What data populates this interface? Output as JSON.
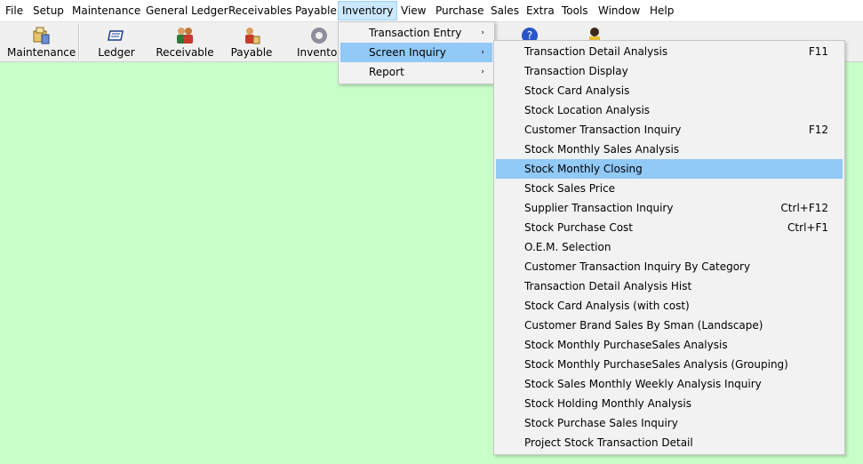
{
  "menubar": [
    "File",
    "Setup",
    "Maintenance",
    "General Ledger",
    "Receivables",
    "Payable",
    "Inventory",
    "View",
    "Purchase",
    "Sales",
    "Extra",
    "Tools",
    "Window",
    "Help"
  ],
  "toolbar": [
    "Maintenance",
    "Ledger",
    "Receivable",
    "Payable",
    "Inventory"
  ],
  "inventory_menu": {
    "items": [
      "Transaction Entry",
      "Screen Inquiry",
      "Report"
    ],
    "arrow": "›"
  },
  "screen_inquiry_menu": {
    "items": [
      {
        "label": "Transaction Detail Analysis",
        "shortcut": "F11"
      },
      {
        "label": "Transaction Display",
        "shortcut": ""
      },
      {
        "label": "Stock Card Analysis",
        "shortcut": ""
      },
      {
        "label": "Stock Location Analysis",
        "shortcut": ""
      },
      {
        "label": "Customer Transaction Inquiry",
        "shortcut": "F12"
      },
      {
        "label": "Stock Monthly Sales Analysis",
        "shortcut": ""
      },
      {
        "label": "Stock Monthly Closing",
        "shortcut": ""
      },
      {
        "label": "Stock Sales Price",
        "shortcut": ""
      },
      {
        "label": "Supplier Transaction Inquiry",
        "shortcut": "Ctrl+F12"
      },
      {
        "label": "Stock Purchase Cost",
        "shortcut": "Ctrl+F1"
      },
      {
        "label": "O.E.M. Selection",
        "shortcut": ""
      },
      {
        "label": "Customer Transaction Inquiry By Category",
        "shortcut": ""
      },
      {
        "label": "Transaction Detail Analysis Hist",
        "shortcut": ""
      },
      {
        "label": "Stock Card Analysis (with cost)",
        "shortcut": ""
      },
      {
        "label": "Customer Brand Sales By Sman (Landscape)",
        "shortcut": ""
      },
      {
        "label": "Stock Monthly PurchaseSales Analysis",
        "shortcut": ""
      },
      {
        "label": "Stock Monthly PurchaseSales Analysis (Grouping)",
        "shortcut": ""
      },
      {
        "label": "Stock Sales Monthly Weekly Analysis Inquiry",
        "shortcut": ""
      },
      {
        "label": "Stock Holding Monthly Analysis",
        "shortcut": ""
      },
      {
        "label": "Stock Purchase Sales Inquiry",
        "shortcut": ""
      },
      {
        "label": "Project Stock Transaction Detail",
        "shortcut": ""
      }
    ]
  },
  "colors": {
    "workspace": "#c8fec8",
    "menu_highlight": "#91c9f7",
    "menubar_active": "#cce8ff"
  }
}
